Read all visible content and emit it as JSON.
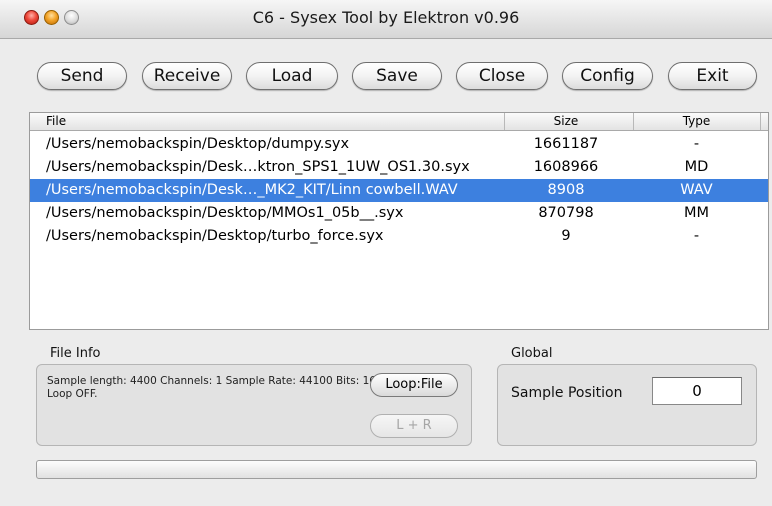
{
  "window": {
    "title": "C6 - Sysex Tool by Elektron v0.96"
  },
  "toolbar": {
    "send": "Send",
    "receive": "Receive",
    "load": "Load",
    "save": "Save",
    "close": "Close",
    "config": "Config",
    "exit": "Exit"
  },
  "file_list": {
    "columns": {
      "file": "File",
      "size": "Size",
      "type": "Type"
    },
    "rows": [
      {
        "file": "/Users/nemobackspin/Desktop/dumpy.syx",
        "size": "1661187",
        "type": "-"
      },
      {
        "file": "/Users/nemobackspin/Desk…ktron_SPS1_1UW_OS1.30.syx",
        "size": "1608966",
        "type": "MD"
      },
      {
        "file": "/Users/nemobackspin/Desk…_MK2_KIT/Linn cowbell.WAV",
        "size": "8908",
        "type": "WAV"
      },
      {
        "file": "/Users/nemobackspin/Desktop/MMOs1_05b__.syx",
        "size": "870798",
        "type": "MM"
      },
      {
        "file": "/Users/nemobackspin/Desktop/turbo_force.syx",
        "size": "9",
        "type": "-"
      }
    ],
    "selected_index": 2
  },
  "file_info": {
    "label": "File Info",
    "text": "Sample length: 4400 Channels: 1 Sample Rate: 44100 Bits: 16 Loop OFF.",
    "loop_button": "Loop:File",
    "lr_button": "L + R"
  },
  "global": {
    "label": "Global",
    "sample_position_label": "Sample Position",
    "sample_position_value": "0"
  },
  "progress": {
    "fraction": 0
  },
  "colors": {
    "selection": "#3d80df"
  }
}
